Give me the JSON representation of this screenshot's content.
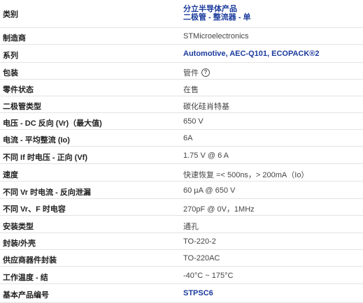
{
  "rows": [
    {
      "label": "类别",
      "value_line1": "分立半导体产品",
      "value_line2": "二极管 - 整流器 - 单"
    },
    {
      "label": "制造商",
      "value": "STMicroelectronics"
    },
    {
      "label": "系列",
      "value": "Automotive, AEC-Q101, ECOPACK®2"
    },
    {
      "label": "包装",
      "value": "管件"
    },
    {
      "label": "零件状态",
      "value": "在售"
    },
    {
      "label": "二极管类型",
      "value": "碳化硅肖特基"
    },
    {
      "label": "电压 - DC 反向 (Vr)（最大值)",
      "value": "650 V"
    },
    {
      "label": "电流 - 平均整流 (Io)",
      "value": "6A"
    },
    {
      "label": "不同 If 时电压 - 正向 (Vf)",
      "value": "1.75 V @ 6 A"
    },
    {
      "label": "速度",
      "value": "快速恢复 =< 500ns，> 200mA（Io）"
    },
    {
      "label": "不同 Vr 时电流 - 反向泄漏",
      "value": "60 µA @ 650 V"
    },
    {
      "label": "不同 Vr、F 时电容",
      "value": "270pF @ 0V，1MHz"
    },
    {
      "label": "安装类型",
      "value": "通孔"
    },
    {
      "label": "封装/外壳",
      "value": "TO-220-2"
    },
    {
      "label": "供应商器件封装",
      "value": "TO-220AC"
    },
    {
      "label": "工作温度 - 结",
      "value": "-40°C ~ 175°C"
    },
    {
      "label": "基本产品编号",
      "value": "STPSC6"
    }
  ],
  "help_icon_glyph": "?",
  "colors": {
    "link": "#1a3a9c",
    "divider": "#e3e3e3"
  }
}
